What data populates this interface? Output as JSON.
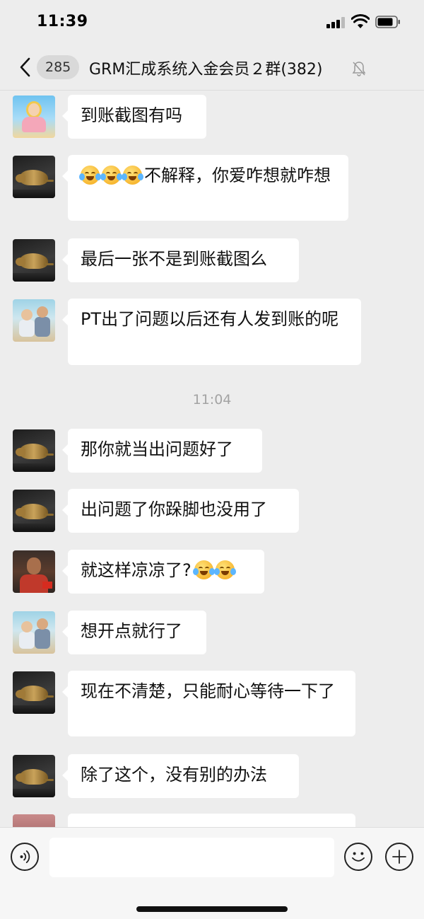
{
  "status_bar": {
    "time": "11:39"
  },
  "nav": {
    "unread_count": "285",
    "title": "GRM汇成系统入金会员２群(382)",
    "icons": {
      "back": "chevron-left-icon",
      "mute": "bell-muted-icon"
    }
  },
  "messages": [
    {
      "avatar": "baby",
      "text": "到账截图有吗"
    },
    {
      "avatar": "rat",
      "emoji_count": 3,
      "text": "不解释，你爱咋想就咋想"
    },
    {
      "avatar": "rat",
      "text": "最后一张不是到账截图么"
    },
    {
      "avatar": "kids",
      "text": "PT出了问题以后还有人发到账的呢"
    },
    {
      "avatar": "rat",
      "text": "那你就当出问题好了"
    },
    {
      "avatar": "rat",
      "text": "出问题了你跺脚也没用了"
    },
    {
      "avatar": "person",
      "text": "就这样凉凉了?",
      "emoji_count": 2
    },
    {
      "avatar": "kids",
      "text": "想开点就行了"
    },
    {
      "avatar": "rat",
      "text": "现在不清楚，只能耐心等待一下了"
    },
    {
      "avatar": "rat",
      "text": "除了这个，没有别的办法"
    }
  ],
  "time_separator": "11:04",
  "input_bar": {
    "text_value": "",
    "icons": {
      "voice": "voice-input-icon",
      "emoji": "emoji-icon",
      "more": "plus-icon"
    }
  }
}
